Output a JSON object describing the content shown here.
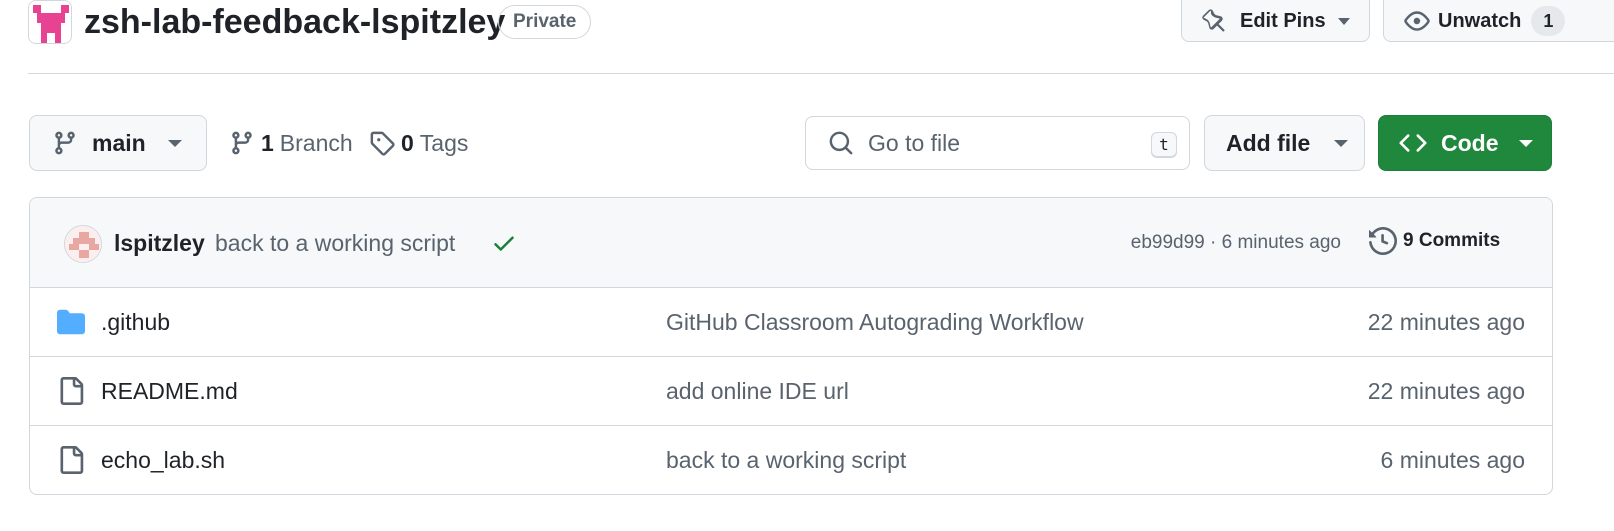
{
  "repo": {
    "name": "zsh-lab-feedback-lspitzley",
    "visibility": "Private",
    "edit_pins_label": "Edit Pins",
    "unwatch_label": "Unwatch",
    "watch_count": "1"
  },
  "toolbar": {
    "branch": "main",
    "branches_count": "1",
    "branches_label": "Branch",
    "tags_count": "0",
    "tags_label": "Tags",
    "search_placeholder": "Go to file",
    "search_shortcut": "t",
    "add_file_label": "Add file",
    "code_label": "Code"
  },
  "latest_commit": {
    "author": "lspitzley",
    "message": "back to a working script",
    "status": "success",
    "hash_and_time": "eb99d99 · 6 minutes ago",
    "commits_label": "9 Commits"
  },
  "files": [
    {
      "type": "folder",
      "name": ".github",
      "message": "GitHub Classroom Autograding Workflow",
      "age": "22 minutes ago"
    },
    {
      "type": "file",
      "name": "README.md",
      "message": "add online IDE url",
      "age": "22 minutes ago"
    },
    {
      "type": "file",
      "name": "echo_lab.sh",
      "message": "back to a working script",
      "age": "6 minutes ago"
    }
  ],
  "colors": {
    "accent_green": "#1f883d",
    "folder_blue": "#54aeff",
    "avatar_pink": "#e84393"
  }
}
